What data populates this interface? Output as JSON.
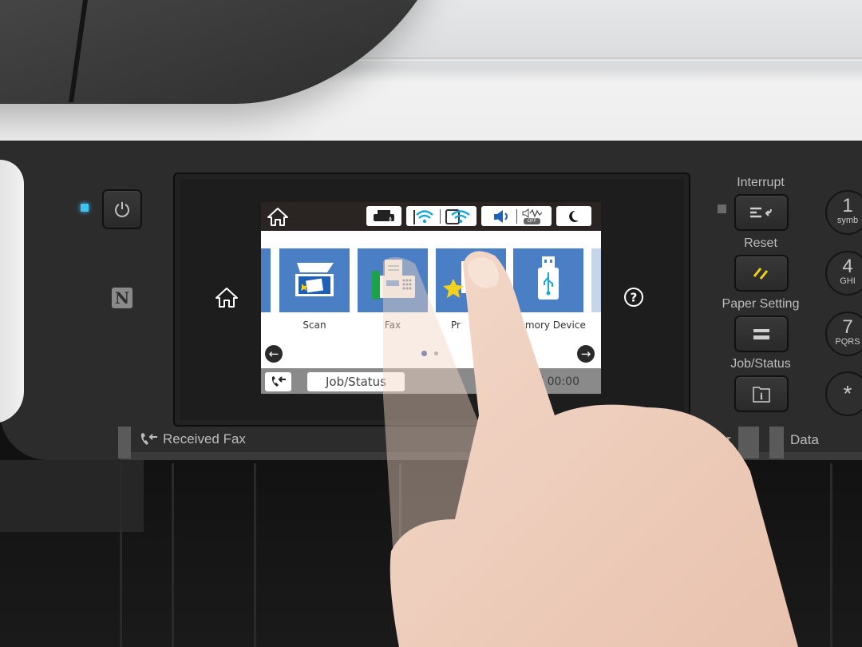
{
  "device": {
    "type": "printer-control-panel",
    "power_led_color": "#3ec3f0",
    "nfc_label": "N"
  },
  "screen": {
    "status_bar": {
      "home_icon": "home-icon",
      "icons": [
        {
          "name": "printer-ink-icon"
        },
        {
          "name": "wifi-router-icon",
          "group": "network"
        },
        {
          "name": "wifi-direct-device-icon",
          "group": "network"
        },
        {
          "name": "speaker-volume-icon",
          "group": "sound"
        },
        {
          "name": "quiet-mode-off-icon",
          "group": "sound",
          "badge": "OFF"
        },
        {
          "name": "sleep-moon-icon"
        }
      ]
    },
    "tiles": [
      {
        "label": "Scan",
        "icon": "scanner-icon"
      },
      {
        "label": "Fax",
        "icon": "fax-machine-icon"
      },
      {
        "label": "Pr",
        "icon": "preset-star-icon"
      },
      {
        "label": "Memory Device",
        "icon": "usb-drive-icon"
      }
    ],
    "tile_color": "#4a7fc5",
    "pagination": {
      "current": 1,
      "total": 2,
      "active_color": "#3a4fa8",
      "inactive_color": "#9a9a9a"
    },
    "bottom_bar": {
      "fax_button_icon": "received-fax-icon",
      "job_status_label": "Job/Status",
      "clock": "7 00:00"
    }
  },
  "bezel": {
    "home_icon": "home-icon",
    "help_icon": "help-icon"
  },
  "side_buttons": [
    {
      "label": "Interrupt",
      "icon": "interrupt-icon"
    },
    {
      "label": "Reset",
      "icon": "reset-icon",
      "icon_color": "#f2d21a"
    },
    {
      "label": "Paper Setting",
      "icon": "paper-tray-icon"
    },
    {
      "label": "Job/Status",
      "icon": "job-status-info-icon"
    }
  ],
  "keypad": [
    {
      "num": "1",
      "sub": "symb"
    },
    {
      "num": "4",
      "sub": "GHI"
    },
    {
      "num": "7",
      "sub": "PQRS"
    },
    {
      "num": "*",
      "sub": ""
    }
  ],
  "indicators": {
    "received_fax": "Received Fax",
    "error": "Error",
    "data": "Data"
  }
}
